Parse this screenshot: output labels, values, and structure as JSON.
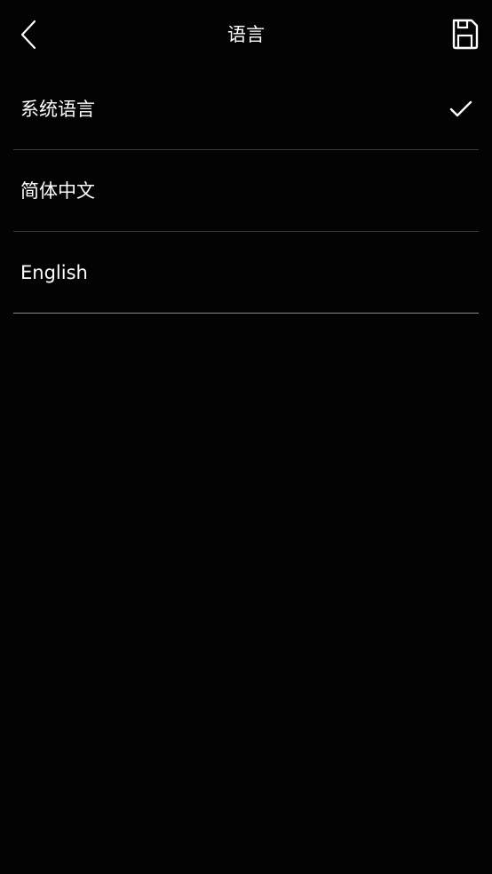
{
  "header": {
    "title": "语言",
    "back_icon": "chevron-left-icon",
    "save_icon": "floppy-save-icon"
  },
  "languages": [
    {
      "label": "系统语言",
      "selected": true
    },
    {
      "label": "简体中文",
      "selected": false
    },
    {
      "label": "English",
      "selected": false
    }
  ],
  "selected_icon": "checkmark-icon",
  "colors": {
    "background": "#030303",
    "text": "#ffffff",
    "divider": "#3a3a3a",
    "divider_last": "#8a8a8a"
  }
}
